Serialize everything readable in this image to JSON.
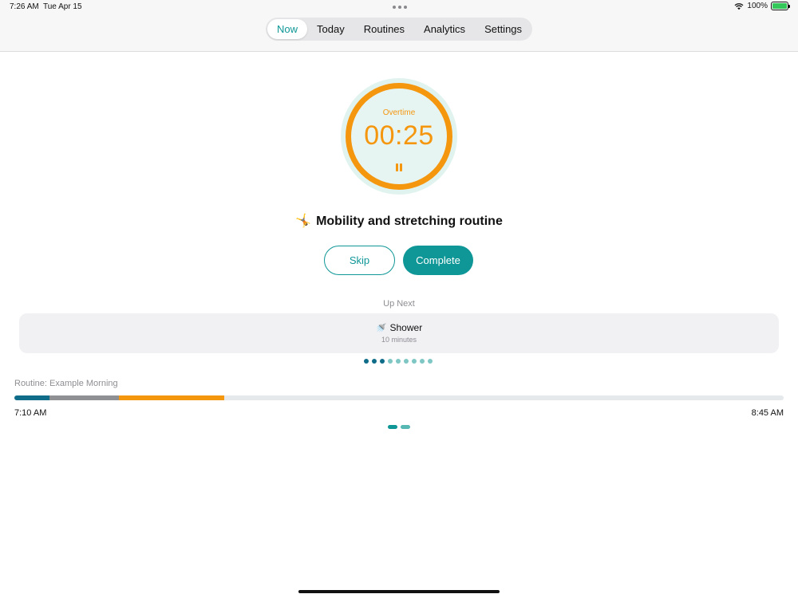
{
  "status_bar": {
    "time": "7:26 AM",
    "date": "Tue Apr 15",
    "battery": "100%",
    "wifi_icon": "wifi-icon",
    "battery_icon": "battery-charging-icon"
  },
  "tabs": [
    {
      "label": "Now",
      "active": true
    },
    {
      "label": "Today",
      "active": false
    },
    {
      "label": "Routines",
      "active": false
    },
    {
      "label": "Analytics",
      "active": false
    },
    {
      "label": "Settings",
      "active": false
    }
  ],
  "timer": {
    "label": "Overtime",
    "value": "00:25",
    "pause_icon": "pause-icon"
  },
  "task": {
    "emoji": "🤸",
    "title": "Mobility and stretching routine"
  },
  "actions": {
    "skip_label": "Skip",
    "complete_label": "Complete"
  },
  "up_next": {
    "label": "Up Next",
    "emoji": "🚿",
    "name": "Shower",
    "duration": "10 minutes"
  },
  "task_dots": {
    "total": 9,
    "done": 3
  },
  "routine": {
    "label": "Routine: Example Morning",
    "start_time": "7:10 AM",
    "end_time": "8:45 AM",
    "segments": [
      {
        "fraction": 0.046,
        "color": "#106d8a"
      },
      {
        "fraction": 0.09,
        "color": "#8e9094"
      },
      {
        "fraction": 0.137,
        "color": "#f5960f"
      }
    ]
  },
  "pager": {
    "total": 2,
    "active": 0
  },
  "colors": {
    "accent": "#0f9696",
    "overtime": "#f5960f",
    "done_dot": "#106d8a",
    "pending_dot": "#7fc7c4"
  }
}
